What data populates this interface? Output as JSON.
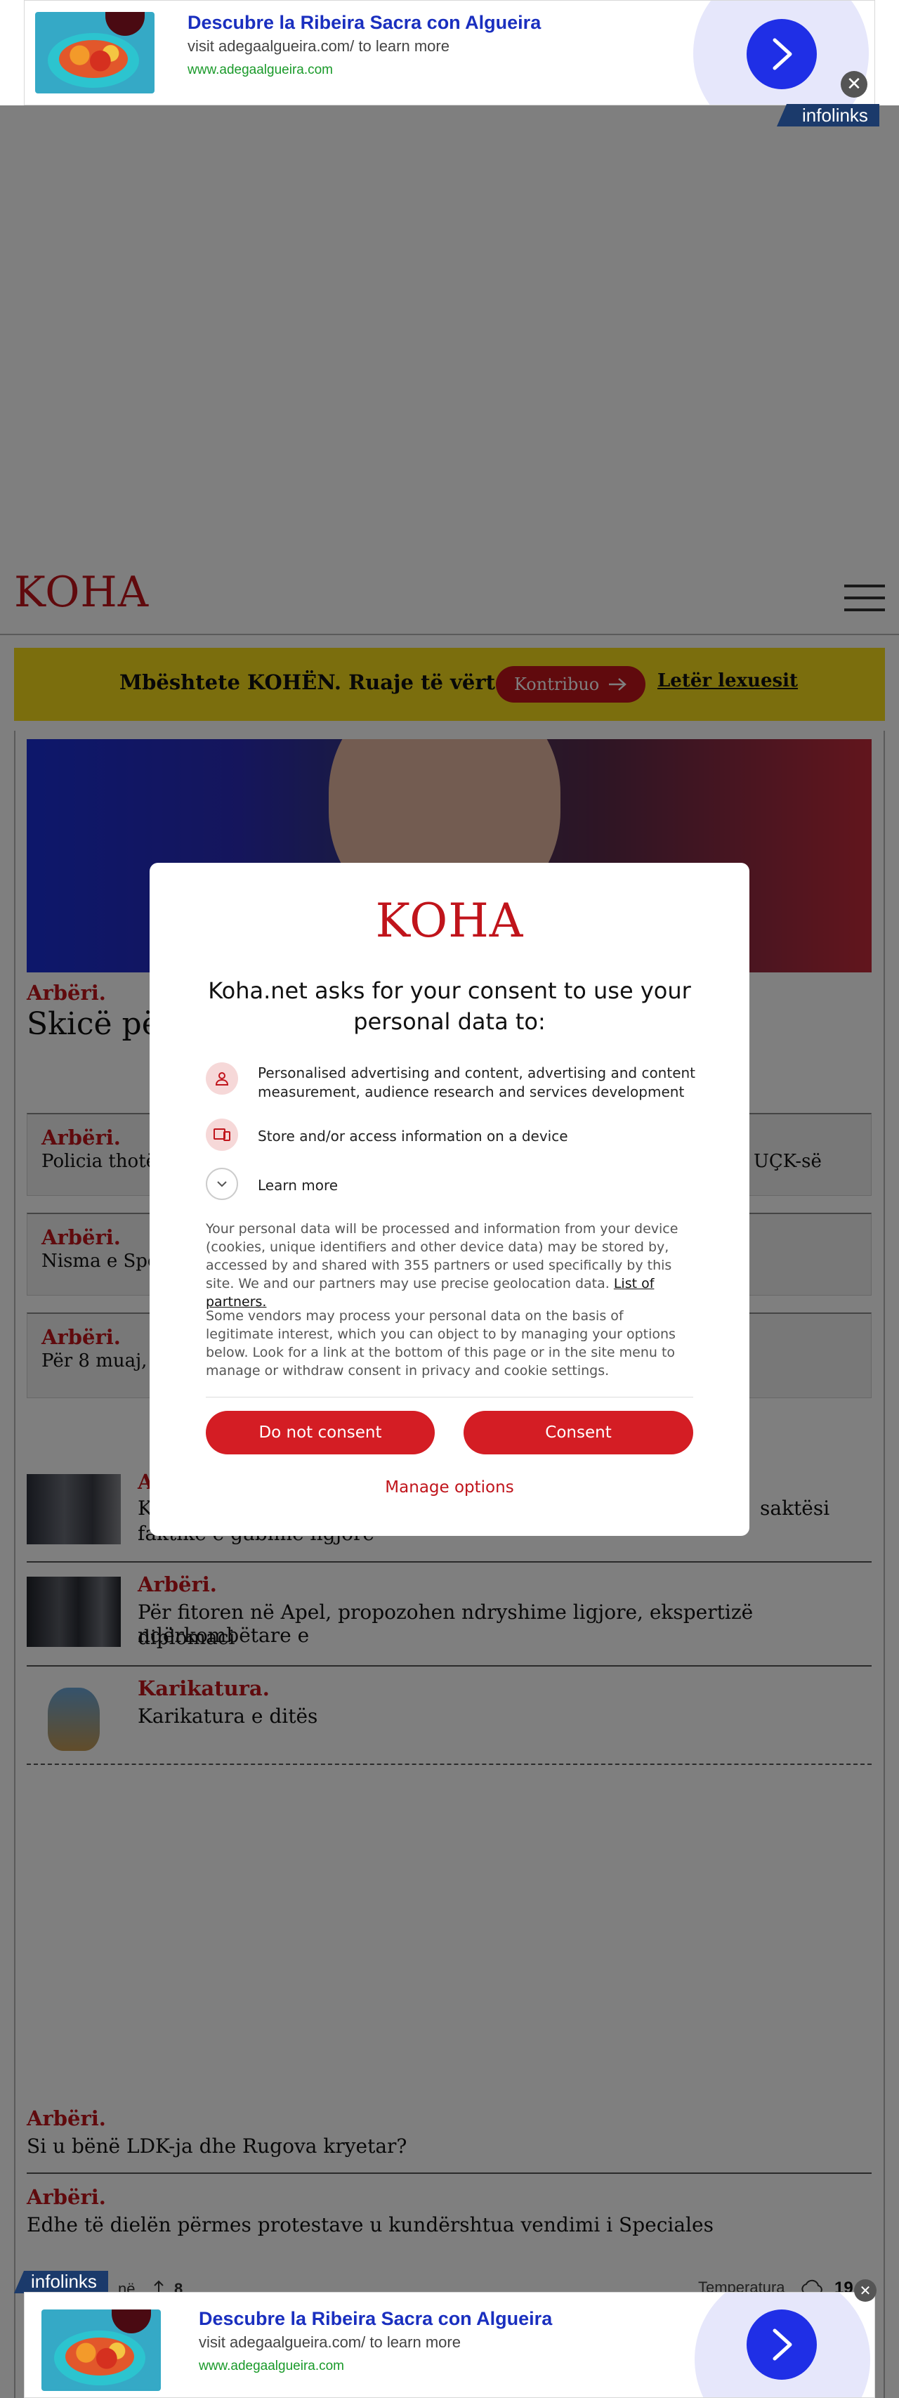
{
  "ad": {
    "title": "Descubre la Ribeira Sacra con Algueira",
    "subtitle": "visit adegaalgueira.com/ to learn more",
    "url": "www.adegaalgueira.com",
    "close_glyph": "✕",
    "network": "infolinks",
    "cta_icon": "chevron-right-icon",
    "accent_color": "#1f2fe6"
  },
  "header": {
    "logo": "KOHA",
    "menu_icon": "hamburger-icon",
    "brand_color": "#c0141b"
  },
  "support_bar": {
    "text": "Mbështete KOHËN. Ruaje të vërtetën",
    "button_label": "Kontribuo",
    "button_icon": "arrow-right-icon",
    "link_label": "Letër lexuesit",
    "background_color": "#f7dd1a"
  },
  "lead_article": {
    "kicker": "Arbëri.",
    "title_visible": "Skicë për"
  },
  "boxed_articles": [
    {
      "kicker": "Arbëri.",
      "text_left": "Policia thotë s",
      "text_right": "UÇK-së"
    },
    {
      "kicker": "Arbëri.",
      "text_left": "Nisma e Spec"
    },
    {
      "kicker": "Arbëri.",
      "text_left": "Për 8 muaj, në"
    }
  ],
  "thumb_articles": [
    {
      "kicker": "A",
      "line1_left": "K",
      "line1_right": "saktësi",
      "line2": "faktike e gabime ligjore"
    },
    {
      "kicker": "Arbëri.",
      "line1": "Për fitoren në Apel, propozohen ndryshime ligjore, ekspertizë ndërkombëtare e",
      "line2": "diplomaci"
    },
    {
      "kicker": "Karikatura.",
      "line1": "Karikatura e ditës"
    }
  ],
  "bottom_articles": [
    {
      "kicker": "Arbëri.",
      "title": "Si u bënë LDK-ja dhe Rugova kryetar?"
    },
    {
      "kicker": "Arbëri.",
      "title": "Edhe të dielën përmes protestave u kundërshtua vendimi i Speciales"
    }
  ],
  "footer_strip": {
    "left_text": "në",
    "count": "8",
    "weather_label": "Temperatura",
    "weather_value": "19"
  },
  "consent": {
    "logo": "KOHA",
    "heading": "Koha.net asks for your consent to use your personal data to:",
    "purposes": [
      {
        "icon": "person-icon",
        "text": "Personalised advertising and content, advertising and content measurement, audience research and services development"
      },
      {
        "icon": "devices-icon",
        "text": "Store and/or access information on a device"
      }
    ],
    "learn_more": "Learn more",
    "paragraph1_main": "Your personal data will be processed and information from your device (cookies, unique identifiers and other device data) may be stored by, accessed by and shared with 355 partners or used specifically by this site. We and our partners may use precise geolocation data.",
    "paragraph1_link": "List of partners.",
    "paragraph2": "Some vendors may process your personal data on the basis of legitimate interest, which you can object to by managing your options below. Look for a link at the bottom of this page or in the site menu to manage or withdraw consent in privacy and cookie settings.",
    "btn_decline": "Do not consent",
    "btn_accept": "Consent",
    "manage": "Manage options"
  }
}
